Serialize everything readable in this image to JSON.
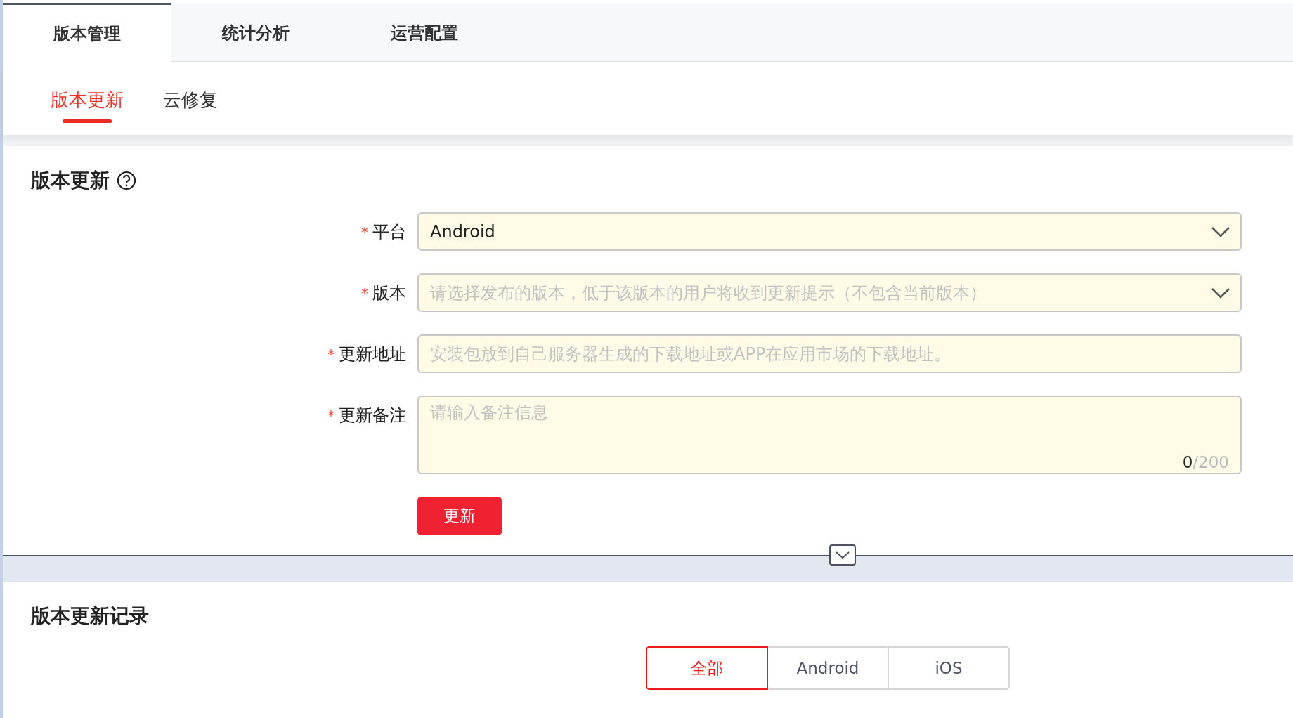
{
  "main_tabs": [
    {
      "label": "版本管理",
      "selected": true
    },
    {
      "label": "统计分析",
      "selected": false
    },
    {
      "label": "运营配置",
      "selected": false
    }
  ],
  "sub_tabs": [
    {
      "label": "版本更新",
      "selected": true
    },
    {
      "label": "云修复",
      "selected": false
    }
  ],
  "update_section": {
    "title": "版本更新",
    "form": [
      {
        "kind": "select",
        "label": "平台",
        "required_mark": "*",
        "value": "Android"
      },
      {
        "kind": "select",
        "label": "版本",
        "required_mark": "*",
        "placeholder": "请选择发布的版本，低于该版本的用户将收到更新提示（不包含当前版本）"
      },
      {
        "kind": "input",
        "label": "更新地址",
        "required_mark": "*",
        "placeholder": "安装包放到自己服务器生成的下载地址或APP在应用市场的下载地址。"
      },
      {
        "kind": "textarea",
        "label": "更新备注",
        "required_mark": "*",
        "placeholder": "请输入备注信息",
        "count": "0",
        "limit": "/200"
      }
    ],
    "submit": "更新"
  },
  "record_section": {
    "title": "版本更新记录",
    "filters": [
      {
        "label": "全部",
        "selected": true
      },
      {
        "label": "Android",
        "selected": false
      },
      {
        "label": "iOS",
        "selected": false
      }
    ]
  }
}
